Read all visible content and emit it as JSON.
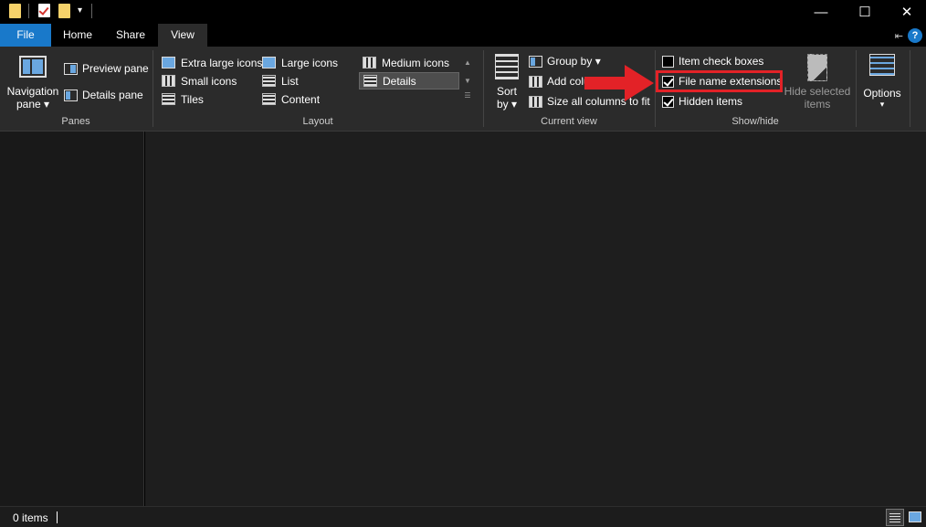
{
  "titlebar": {
    "quick_access_dropdown": "▾",
    "minimize": "—",
    "maximize": "☐",
    "close": "✕"
  },
  "tabs": {
    "file": "File",
    "home": "Home",
    "share": "Share",
    "view": "View"
  },
  "ribbon": {
    "panes": {
      "navigation_pane_line1": "Navigation",
      "navigation_pane_line2": "pane ▾",
      "preview_pane": "Preview pane",
      "details_pane": "Details pane",
      "label": "Panes"
    },
    "layout": {
      "items": [
        "Extra large icons",
        "Large icons",
        "Medium icons",
        "Small icons",
        "List",
        "Details",
        "Tiles",
        "Content"
      ],
      "selected": "Details",
      "label": "Layout"
    },
    "current_view": {
      "sort_line1": "Sort",
      "sort_line2": "by ▾",
      "group_by": "Group by ▾",
      "add_columns": "Add columns",
      "size_all_columns": "Size all columns to fit",
      "label": "Current view"
    },
    "show_hide": {
      "item_check_boxes": {
        "label": "Item check boxes",
        "checked": false
      },
      "file_name_extensions": {
        "label": "File name extensions",
        "checked": true
      },
      "hidden_items": {
        "label": "Hidden items",
        "checked": true
      },
      "hide_selected_line1": "Hide selected",
      "hide_selected_line2": "items",
      "label": "Show/hide"
    },
    "options": {
      "label": "Options",
      "dropdown": "▾"
    }
  },
  "status": {
    "item_count": "0 items"
  },
  "colors": {
    "accent": "#1979ca",
    "highlight": "#e32227",
    "background": "#1e1e1e"
  }
}
